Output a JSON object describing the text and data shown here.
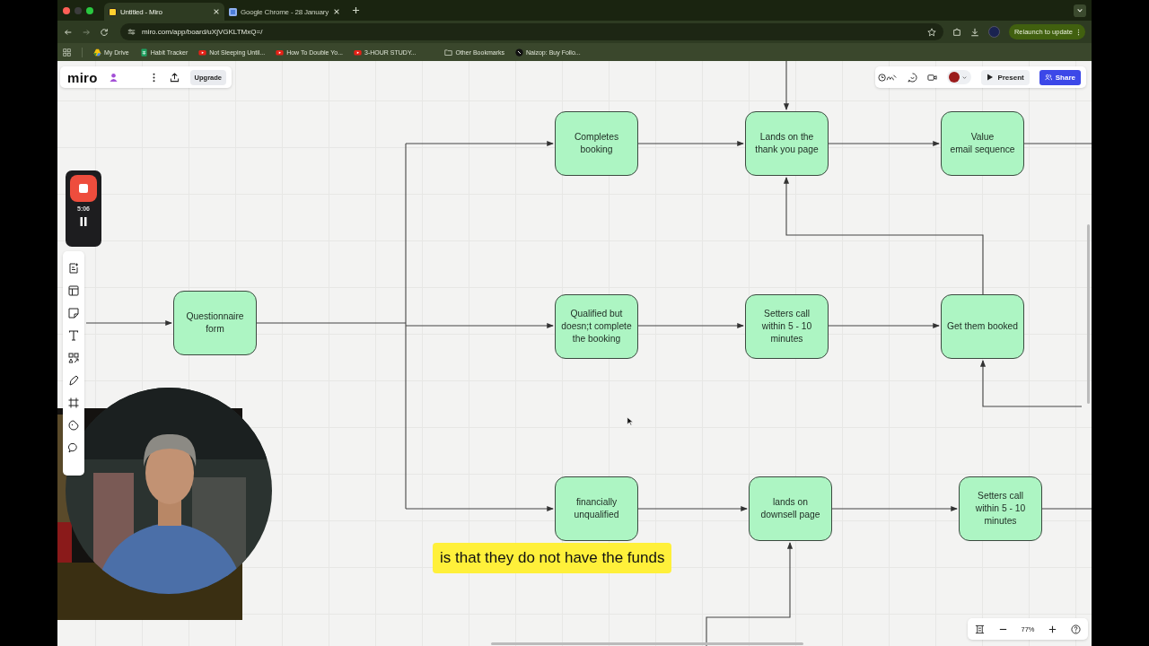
{
  "browser": {
    "tabs": [
      {
        "title": "Untitled - Miro",
        "kind": "miro",
        "selected": true
      },
      {
        "title": "Google Chrome - 28 January",
        "kind": "chrome",
        "selected": false
      }
    ],
    "url": "miro.com/app/board/uXjVGKLTMxQ=/",
    "relaunch_button": "Relaunch to update",
    "bookmarks": [
      {
        "label": "My Drive",
        "kind": "drive"
      },
      {
        "label": "Habit Tracker",
        "kind": "sheet"
      },
      {
        "label": "Not Sleeping Until...",
        "kind": "video"
      },
      {
        "label": "How To Double Yo...",
        "kind": "video"
      },
      {
        "label": "3-HOUR STUDY...",
        "kind": "video"
      },
      {
        "label": "Other Bookmarks",
        "kind": "folder"
      },
      {
        "label": "Naizop: Buy Follo...",
        "kind": "site"
      }
    ]
  },
  "board_header": {
    "logo": "miro",
    "upgrade_button": "Upgrade"
  },
  "collab_toolbar": {
    "present_button": "Present",
    "share_button": "Share"
  },
  "recorder": {
    "timer": "5:06"
  },
  "flowchart": {
    "nodes": [
      {
        "lines": [
          "Completes",
          "booking"
        ]
      },
      {
        "lines": [
          "Lands on the",
          "thank you page"
        ]
      },
      {
        "lines": [
          "Value",
          "email sequence"
        ]
      },
      {
        "lines": [
          "Questionnaire",
          "form"
        ]
      },
      {
        "lines": [
          "Qualified but",
          "doesn;t complete",
          "the booking"
        ]
      },
      {
        "lines": [
          "Setters call",
          "within 5 - 10",
          "minutes"
        ]
      },
      {
        "lines": [
          "Get them booked"
        ]
      },
      {
        "lines": [
          "financially",
          "unqualified"
        ]
      },
      {
        "lines": [
          "lands on",
          "downsell page"
        ]
      },
      {
        "lines": [
          "Setters call",
          "within 5 - 10",
          "minutes"
        ]
      }
    ]
  },
  "caption": "is that they do not have the funds",
  "zoom_controls": {
    "zoom_level": "77%"
  }
}
